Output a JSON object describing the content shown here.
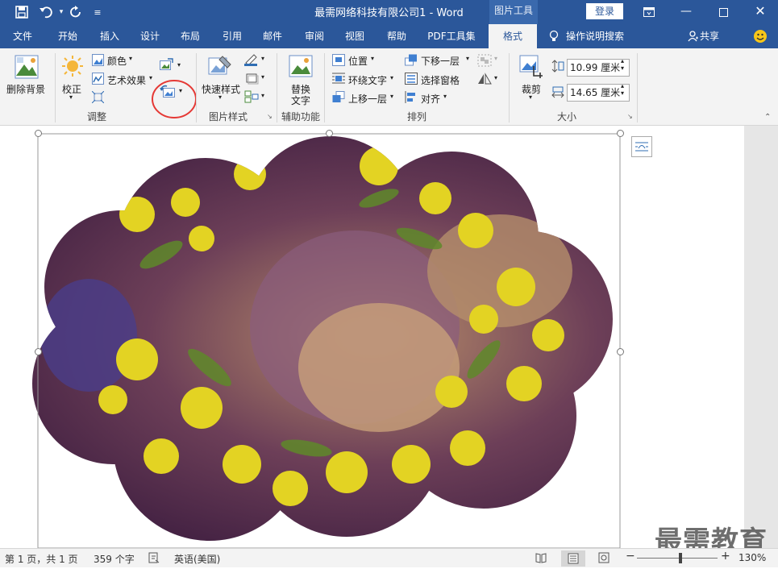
{
  "window": {
    "title": "最需网络科技有限公司1  -  Word",
    "context_tab": "图片工具",
    "login": "登录"
  },
  "tabs": [
    "文件",
    "开始",
    "插入",
    "设计",
    "布局",
    "引用",
    "邮件",
    "审阅",
    "视图",
    "帮助",
    "PDF工具集",
    "格式"
  ],
  "active_tab": "格式",
  "tell_me": "操作说明搜索",
  "share": "共享",
  "ribbon": {
    "remove_bg": "删除背景",
    "correct": "校正",
    "color": "颜色",
    "artistic": "艺术效果",
    "adjust_group": "调整",
    "quick_styles": "快速样式",
    "picture_styles_group": "图片样式",
    "alt_text_line1": "替换",
    "alt_text_line2": "文字",
    "accessibility_group": "辅助功能",
    "position": "位置",
    "wrap_text": "环绕文字",
    "bring_forward": "上移一层",
    "send_backward": "下移一层",
    "selection_pane": "选择窗格",
    "align": "对齐",
    "arrange_group": "排列",
    "crop": "裁剪",
    "height_value": "10.99 厘米",
    "width_value": "14.65 厘米",
    "size_group": "大小"
  },
  "status": {
    "page": "第 1 页，共 1 页",
    "words": "359 个字",
    "language": "英语(美国)",
    "zoom": "130%"
  },
  "watermark": "最需教育",
  "colors": {
    "accent": "#2b579a",
    "ribbon_bg": "#f3f3f3",
    "highlight_circle": "#e53935"
  }
}
